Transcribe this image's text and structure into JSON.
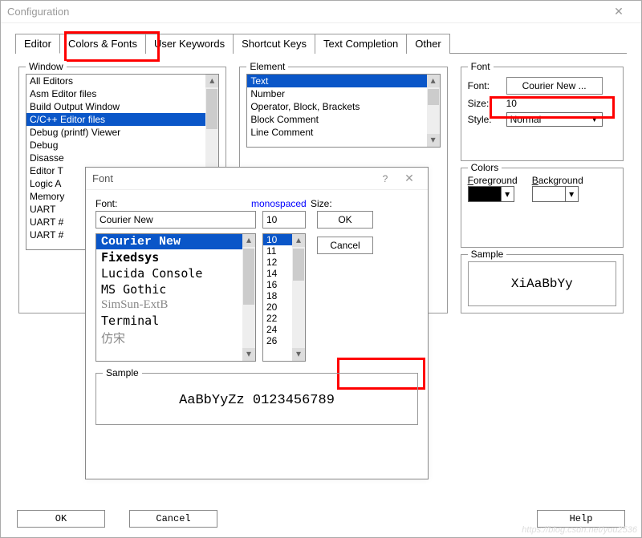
{
  "main": {
    "title": "Configuration",
    "tabs": [
      "Editor",
      "Colors & Fonts",
      "User Keywords",
      "Shortcut Keys",
      "Text Completion",
      "Other"
    ],
    "active_tab": 1,
    "buttons": {
      "ok": "OK",
      "cancel": "Cancel",
      "help": "Help"
    }
  },
  "window_group": {
    "legend": "Window",
    "items": [
      "All Editors",
      "Asm Editor files",
      "Build Output Window",
      "C/C++ Editor files",
      "Debug (printf) Viewer",
      "Debug",
      "Disasse",
      "Editor T",
      "Logic A",
      "Memory",
      "UART",
      "UART #",
      "UART #"
    ],
    "selected": 3
  },
  "element_group": {
    "legend": "Element",
    "items": [
      "Text",
      "Number",
      "Operator, Block, Brackets",
      "Block Comment",
      "Line Comment"
    ],
    "selected": 0
  },
  "font_group": {
    "legend": "Font",
    "font_label": "Font:",
    "font_button": "Courier New ...",
    "size_label": "Size:",
    "size_value": "10",
    "style_label": "Style:",
    "style_value": "Normal"
  },
  "colors_group": {
    "legend": "Colors",
    "fg_label": "Foreground",
    "bg_label": "Background",
    "fg_color": "#000000",
    "bg_color": "#ffffff"
  },
  "sample_group": {
    "legend": "Sample",
    "text": "XiAaBbYy"
  },
  "font_dialog": {
    "title": "Font",
    "font_label": "Font:",
    "font_type": "monospaced",
    "size_label": "Size:",
    "font_input": "Courier New",
    "size_input": "10",
    "font_list": [
      "Courier New",
      "Fixedsys",
      "Lucida Console",
      "MS Gothic",
      "SimSun-ExtB",
      "Terminal",
      "仿宋"
    ],
    "font_selected": 0,
    "size_list": [
      "10",
      "11",
      "12",
      "14",
      "16",
      "18",
      "20",
      "22",
      "24",
      "26"
    ],
    "size_selected": 0,
    "ok": "OK",
    "cancel": "Cancel",
    "sample_legend": "Sample",
    "sample_text": "AaBbYyZz 0123456789"
  },
  "watermark": "https://blog.csdn.net/you2536"
}
